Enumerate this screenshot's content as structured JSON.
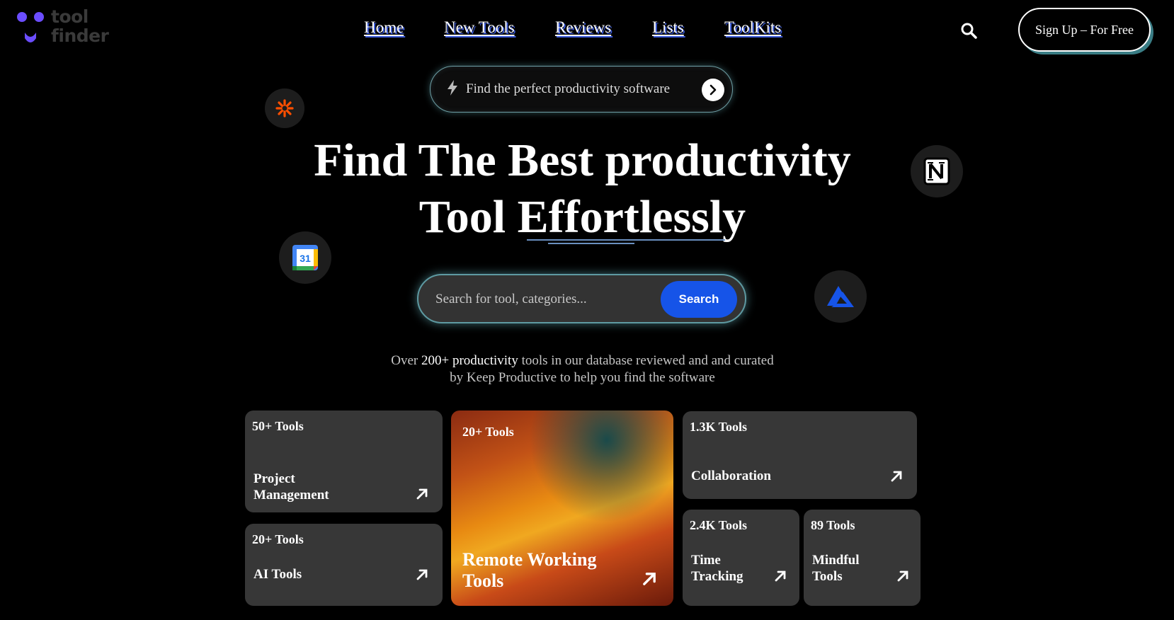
{
  "logo": {
    "line1": "tool",
    "line2": "finder"
  },
  "nav": [
    "Home",
    "New Tools",
    "Reviews",
    "Lists",
    "ToolKits"
  ],
  "signup_label": "Sign Up – For Free",
  "pill_text": "Find the perfect productivity software",
  "hero": {
    "line1": "Find The Best productivity",
    "line2": "Tool Effortlessly"
  },
  "search": {
    "placeholder": "Search for tool, categories...",
    "button": "Search"
  },
  "subtext": {
    "before": "Over ",
    "highlight": "200+ productivity",
    "after": " tools in our database reviewed and and curated",
    "line2": "by Keep Productive to help you find the software"
  },
  "cards": [
    {
      "count": "50+ Tools",
      "label": "Project Management",
      "label1": "Project",
      "label2": "Management"
    },
    {
      "count": "20+ Tools",
      "label": "AI Tools"
    },
    {
      "count": "20+ Tools",
      "label1": "Remote Working",
      "label2": "Tools"
    },
    {
      "count": "1.3K Tools",
      "label": "Collaboration"
    },
    {
      "count": "2.4K Tools",
      "label1": "Time",
      "label2": "Tracking"
    },
    {
      "count": "89 Tools",
      "label1": "Mindful",
      "label2": "Tools"
    }
  ],
  "colors": {
    "accent_blue": "#1654e8",
    "glow": "#5e9aa2",
    "card_bg": "#373737",
    "logo_purple": "#6b4dff"
  },
  "icons": [
    "zapier-icon",
    "notion-icon",
    "google-calendar-icon",
    "azure-icon",
    "search-icon",
    "lightning-icon",
    "chevron-right-icon",
    "arrow-up-right-icon"
  ],
  "calendar_day": "31"
}
